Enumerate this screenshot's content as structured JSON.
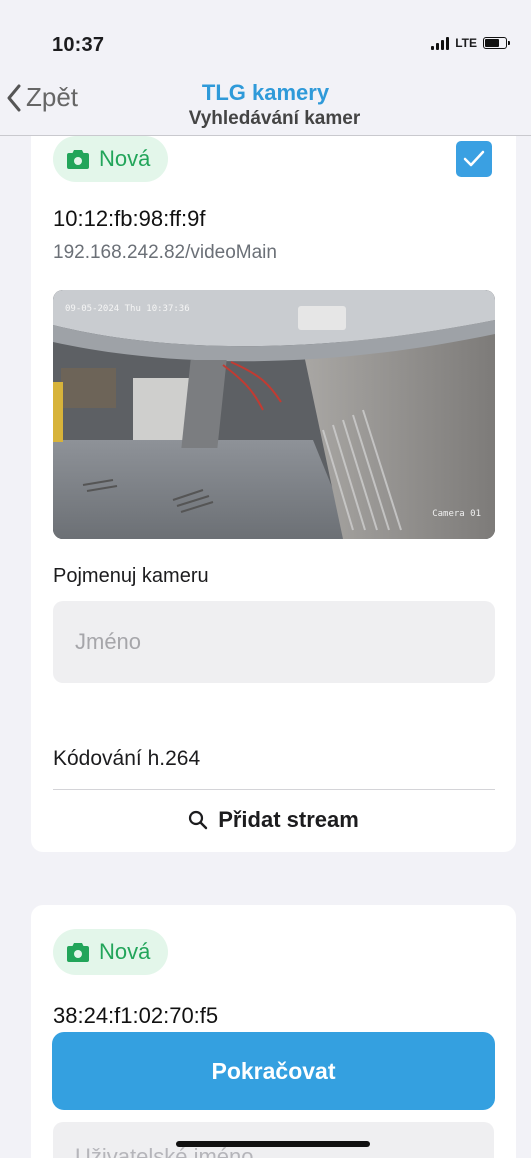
{
  "status_bar": {
    "time": "10:37",
    "network": "LTE",
    "signal_bars": 4,
    "battery_level": 0.7
  },
  "navbar": {
    "back_label": "Zpět",
    "title": "TLG kamery",
    "subtitle": "Vyhledávání kamer"
  },
  "cameras": [
    {
      "badge": "Nová",
      "selected": true,
      "mac": "10:12:fb:98:ff:9f",
      "url": "192.168.242.82/videoMain",
      "preview": {
        "osd_datetime": "09-05-2024 Thu 10:37:36",
        "osd_camera": "Camera 01"
      },
      "name_label": "Pojmenuj kameru",
      "name_placeholder": "Jméno",
      "name_value": "",
      "encoding": "Kódování h.264",
      "add_stream_label": "Přidat stream"
    },
    {
      "badge": "Nová",
      "mac": "38:24:f1:02:70:f5",
      "username_placeholder": "Uživatelské jméno"
    }
  ],
  "continue_label": "Pokračovat",
  "colors": {
    "accent": "#34a0e0",
    "title": "#2f9ad9",
    "badge_text": "#22a55a",
    "badge_bg": "#e3f6ea",
    "background": "#f2f2f7"
  },
  "icons": {
    "back": "chevron-left-icon",
    "badge": "camera-icon",
    "checkbox": "checkmark-icon",
    "add_stream": "search-icon"
  }
}
